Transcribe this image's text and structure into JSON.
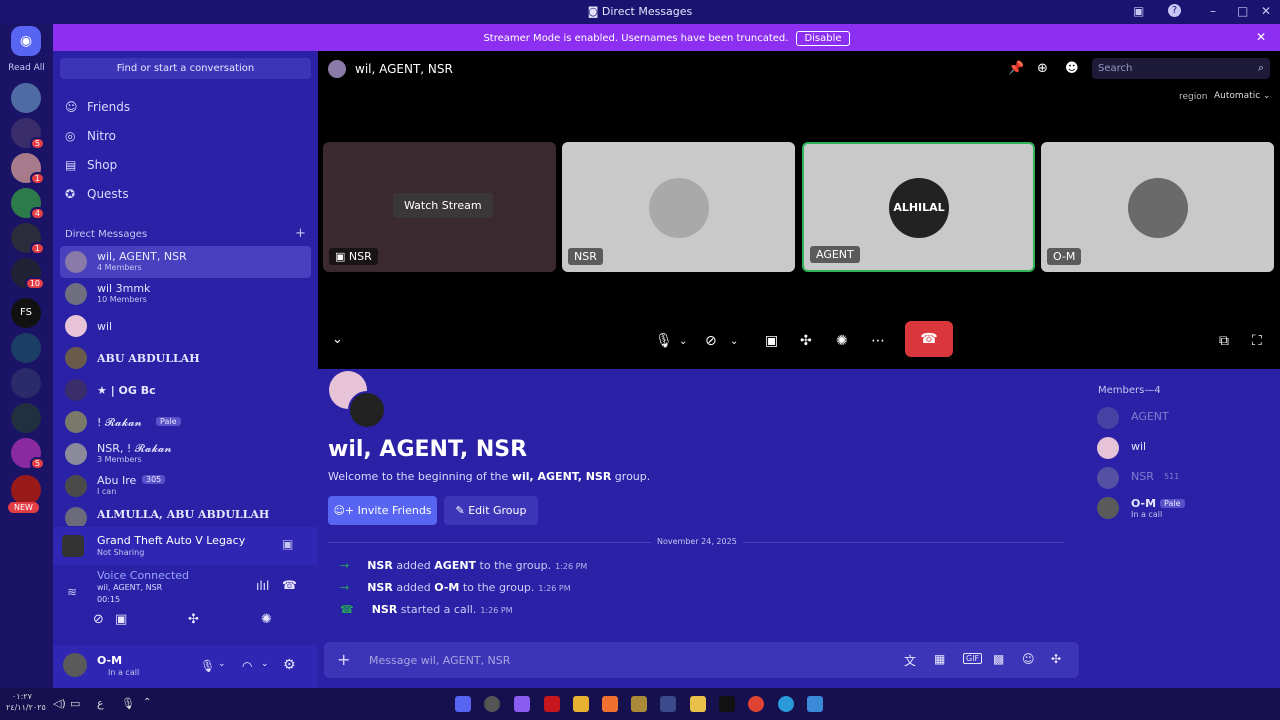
{
  "window": {
    "title": "Direct Messages"
  },
  "banner": {
    "message": "Streamer Mode is enabled. Usernames have been truncated.",
    "button": "Disable"
  },
  "rail": {
    "read_all": "Read All",
    "badges": [
      "5",
      "1",
      "4",
      "1",
      "10",
      "5"
    ],
    "new_badge": "NEW",
    "fs_label": "FS"
  },
  "dm_sidebar": {
    "search_placeholder": "Find or start a conversation",
    "nav": [
      {
        "label": "Friends"
      },
      {
        "label": "Nitro"
      },
      {
        "label": "Shop"
      },
      {
        "label": "Quests"
      }
    ],
    "section_title": "Direct Messages",
    "items": [
      {
        "name": "wil, AGENT, NSR",
        "sub": "4 Members"
      },
      {
        "name": "wil 3mmk",
        "sub": "10 Members"
      },
      {
        "name": "wil",
        "sub": ""
      },
      {
        "name": "ABU ABDULLAH",
        "sub": ""
      },
      {
        "name": "★ | OG Bc",
        "sub": ""
      },
      {
        "name": "! 𝓡𝓪𝓴𝓪𝓷",
        "sub": "",
        "tag": "Pale"
      },
      {
        "name": "NSR, ! 𝓡𝓪𝓴𝓪𝓷",
        "sub": "3 Members"
      },
      {
        "name": "Abu Ire",
        "sub": "I can",
        "tag": "305"
      },
      {
        "name": "ALMULLA, ABU ABDULLAH",
        "sub": ""
      }
    ],
    "activity": {
      "game": "Grand Theft Auto V Legacy",
      "status": "Not Sharing"
    },
    "voice": {
      "status": "Voice Connected",
      "channel": "wil, AGENT, NSR",
      "timer": "00:15"
    },
    "user": {
      "name": "O-M",
      "status": "In a call"
    }
  },
  "call": {
    "title": "wil, AGENT, NSR",
    "search_placeholder": "Search",
    "region_label": "region",
    "region_value": "Automatic",
    "watch_stream": "Watch Stream",
    "tiles": [
      {
        "label": "NSR"
      },
      {
        "label": "NSR"
      },
      {
        "label": "AGENT"
      },
      {
        "label": "O-M"
      }
    ],
    "agent_avatar_text": "ALHILAL"
  },
  "chat": {
    "title": "wil, AGENT, NSR",
    "welcome_prefix": "Welcome to the beginning of the ",
    "welcome_name": "wil, AGENT, NSR",
    "welcome_suffix": " group.",
    "invite_button": "Invite Friends",
    "edit_button": "Edit Group",
    "date_divider": "November 24, 2025",
    "messages": [
      {
        "actor": "NSR",
        "verb": " added ",
        "target": "AGENT",
        "rest": " to the group.",
        "time": "1:26 PM"
      },
      {
        "actor": "NSR",
        "verb": " added ",
        "target": "O-M",
        "rest": " to the group.",
        "time": "1:26 PM"
      },
      {
        "actor": "NSR",
        "verb": " started a call.",
        "target": "",
        "rest": "",
        "time": "1:26 PM"
      }
    ],
    "input_placeholder": "Message wil, AGENT, NSR"
  },
  "members": {
    "title": "Members—4",
    "list": [
      {
        "name": "AGENT",
        "extra": ""
      },
      {
        "name": "wil",
        "extra": ""
      },
      {
        "name": "NSR",
        "extra": "511"
      },
      {
        "name": "O-M",
        "extra": "Pale",
        "status": "In a call"
      }
    ]
  },
  "taskbar": {
    "clock_time": "٠١:٢٧",
    "clock_date": "٢٤/١١/٢٠٢٥",
    "lang": "ع"
  },
  "colors": {
    "accent": "#5865f2",
    "hangup": "#da373c",
    "banner": "#8d2ff0",
    "sidebar": "#2a21a6",
    "online": "#23a55a"
  }
}
